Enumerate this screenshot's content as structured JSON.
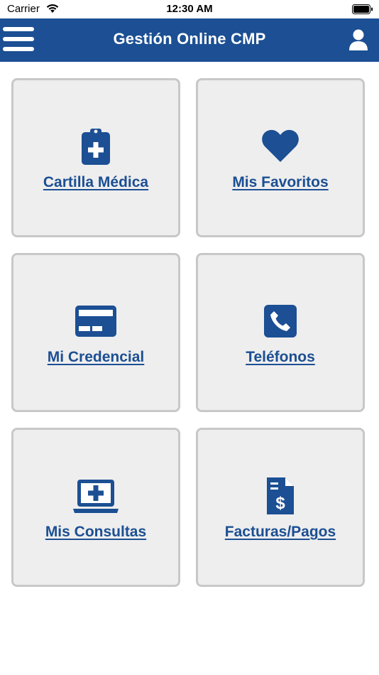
{
  "status_bar": {
    "carrier": "Carrier",
    "time": "12:30 AM"
  },
  "header": {
    "title": "Gestión Online CMP",
    "menu_icon": "hamburger-menu-icon",
    "user_icon": "user-icon"
  },
  "tiles": [
    {
      "label": "Cartilla Médica",
      "icon": "clipboard-medical-icon"
    },
    {
      "label": "Mis Favoritos",
      "icon": "heart-icon"
    },
    {
      "label": "Mi Credencial",
      "icon": "credit-card-icon"
    },
    {
      "label": "Teléfonos",
      "icon": "phone-square-icon"
    },
    {
      "label": "Mis Consultas",
      "icon": "laptop-medical-icon"
    },
    {
      "label": "Facturas/Pagos",
      "icon": "invoice-dollar-icon"
    }
  ],
  "colors": {
    "primary": "#1c4f93",
    "tile_background": "#eeeeee",
    "tile_border": "#c8c8c8"
  }
}
